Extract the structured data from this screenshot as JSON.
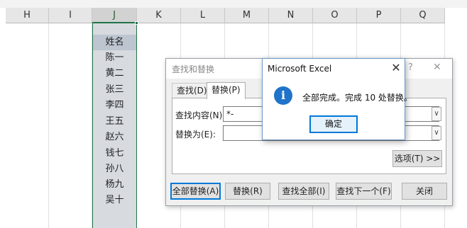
{
  "columns": [
    "H",
    "I",
    "J",
    "K",
    "L",
    "M",
    "N",
    "O",
    "P",
    "Q"
  ],
  "selected_column": "J",
  "cells": [
    "姓名",
    "陈一",
    "黄二",
    "张三",
    "李四",
    "王五",
    "赵六",
    "钱七",
    "孙八",
    "杨九",
    "吴十"
  ],
  "find_dialog": {
    "title": "查找和替换",
    "help_label": "?",
    "close_label": "✕",
    "tabs": [
      {
        "label": "查找(D)",
        "active": false
      },
      {
        "label": "替换(P)",
        "active": true
      }
    ],
    "find_label": "查找内容(N):",
    "find_value": "*-",
    "replace_label": "替换为(E):",
    "replace_value": "",
    "options_button": "选项(T) >>",
    "buttons": {
      "replace_all": "全部替换(A)",
      "replace": "替换(R)",
      "find_all": "查找全部(I)",
      "find_next": "查找下一个(F)",
      "close": "关闭"
    }
  },
  "message_box": {
    "title": "Microsoft Excel",
    "close_label": "✕",
    "icon": "info-icon",
    "text": "全部完成。完成 10 处替换。",
    "ok_label": "确定"
  },
  "colors": {
    "selection_green": "#217346",
    "selected_column_fill": "#d7dbe0",
    "info_blue": "#1f73c9",
    "focus_border": "#0078d7"
  }
}
